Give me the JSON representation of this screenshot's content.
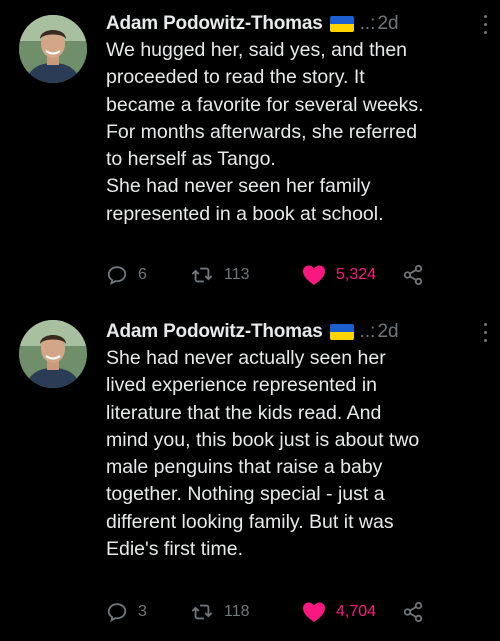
{
  "colors": {
    "background": "#000000",
    "text": "#e7e9ea",
    "muted": "#71767b",
    "like": "#f91880",
    "flag_blue": "#1b5fd1",
    "flag_yellow": "#ffd400"
  },
  "tweets": [
    {
      "author": {
        "name": "Adam Podowitz-Thomas",
        "badge": "ukraine-flag-icon",
        "handle": "..:",
        "time": "2d"
      },
      "lines": [
        "We hugged her, said yes, and then",
        "proceeded to read the story. It",
        "became a favorite for several weeks.",
        "For months afterwards, she referred",
        "to herself as Tango.",
        "She had never seen her family",
        "represented in a book at school."
      ],
      "stats": {
        "replies": "6",
        "retweets": "113",
        "likes": "5,324"
      },
      "liked": true
    },
    {
      "author": {
        "name": "Adam Podowitz-Thomas",
        "badge": "ukraine-flag-icon",
        "handle": "..:",
        "time": "2d"
      },
      "lines": [
        "She had never actually seen her",
        "lived experience represented in",
        "literature that the kids read. And",
        "mind you, this book just is about two",
        "male penguins that raise a baby",
        "together. Nothing special - just a",
        "different looking family. But it was",
        "Edie's first time."
      ],
      "stats": {
        "replies": "3",
        "retweets": "118",
        "likes": "4,704"
      },
      "liked": true
    }
  ]
}
